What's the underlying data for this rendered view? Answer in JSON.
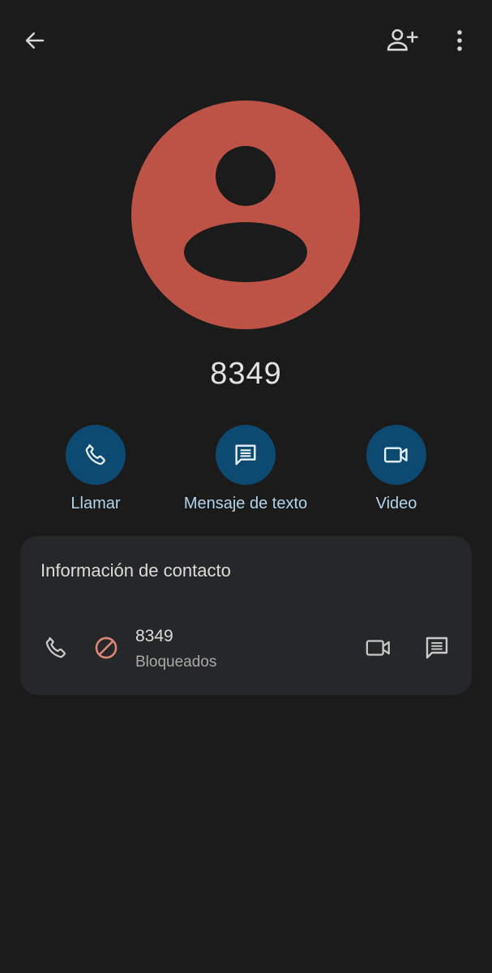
{
  "topbar": {
    "back_icon": "arrow-left-icon",
    "add_contact_icon": "person-add-icon",
    "more_icon": "more-vert-icon"
  },
  "avatar": {
    "color": "#bc5346",
    "icon": "person-placeholder-icon"
  },
  "contact": {
    "name": "8349"
  },
  "actions": [
    {
      "label": "Llamar",
      "icon": "phone-icon"
    },
    {
      "label": "Mensaje de texto",
      "icon": "message-icon"
    },
    {
      "label": "Video",
      "icon": "videocam-icon"
    }
  ],
  "info_card": {
    "title": "Información de contacto",
    "number": "8349",
    "status": "Bloqueados",
    "icons": [
      "phone-icon",
      "block-icon",
      "videocam-icon",
      "message-icon"
    ]
  },
  "colors": {
    "background": "#1b1b1b",
    "card": "#262729",
    "action_circle": "#0c4a72",
    "action_label": "#b4d3ea",
    "blocked_icon": "#e0877c"
  }
}
